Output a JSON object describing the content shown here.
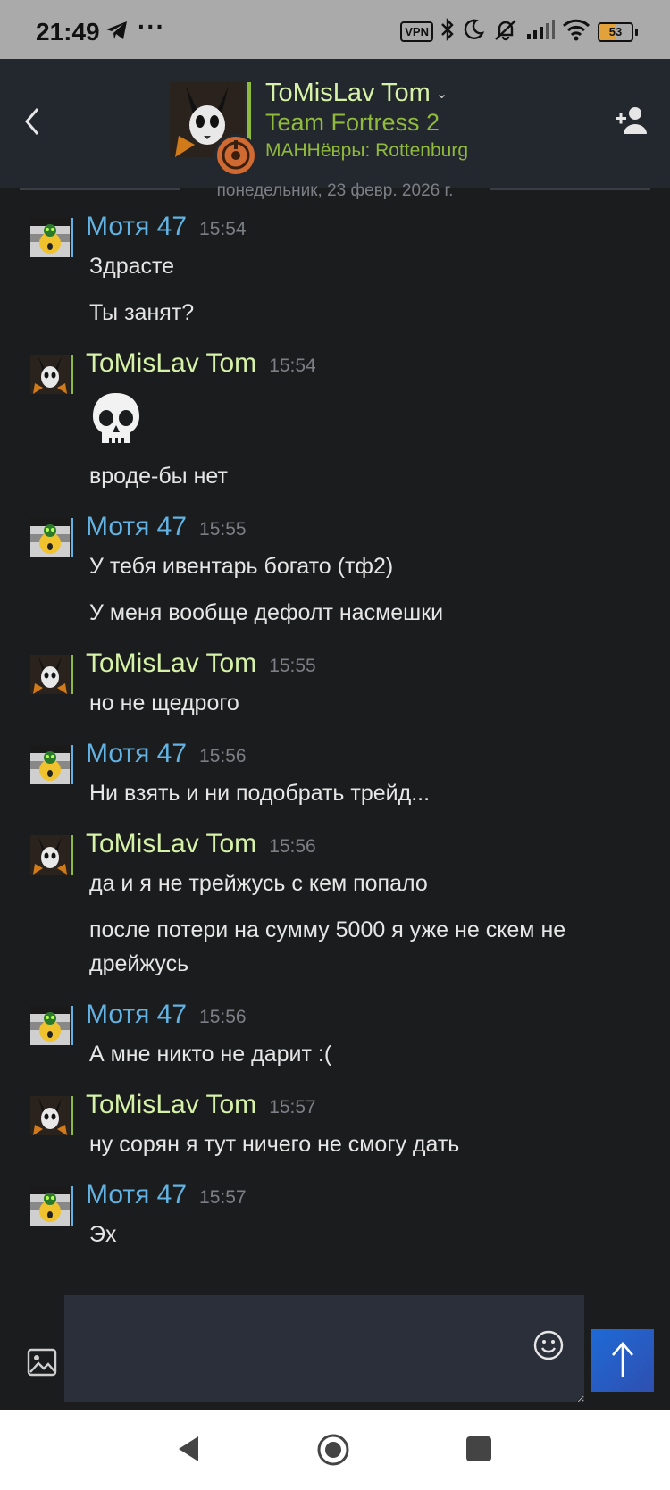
{
  "status_bar": {
    "time": "21:49",
    "more": "···",
    "vpn": "VPN",
    "battery_level": "53"
  },
  "header": {
    "name": "ToMisLav Tom",
    "game": "Team Fortress 2",
    "server": "MAHHёвры: Rottenburg",
    "accent_green": "#90ba3c",
    "name_color": "#d6f2a8"
  },
  "date_separator": "понедельник, 23 февр. 2026 г.",
  "messages": [
    {
      "user": "Мотя 47",
      "time": "15:54",
      "texts": [
        "Здрасте",
        "Ты занят?"
      ]
    },
    {
      "user": "ToMisLav Tom",
      "time": "15:54",
      "emoji": "skull",
      "texts": [
        "вроде-бы нет"
      ]
    },
    {
      "user": "Мотя 47",
      "time": "15:55",
      "texts": [
        "У тебя ивентарь богато (тф2)",
        "У меня вообще дефолт насмешки"
      ]
    },
    {
      "user": "ToMisLav Tom",
      "time": "15:55",
      "texts": [
        "но не щедрого"
      ]
    },
    {
      "user": "Мотя 47",
      "time": "15:56",
      "texts": [
        "Ни взять и ни подобрать трейд..."
      ]
    },
    {
      "user": "ToMisLav Tom",
      "time": "15:56",
      "texts": [
        "да и я не трейжусь с кем попало",
        "после потери на сумму 5000 я уже не скем не дрейжусь"
      ]
    },
    {
      "user": "Мотя 47",
      "time": "15:56",
      "texts": [
        "А мне никто не дарит :("
      ]
    },
    {
      "user": "ToMisLav Tom",
      "time": "15:57",
      "texts": [
        "ну сорян я тут ничего не смогу дать"
      ]
    },
    {
      "user": "Мотя 47",
      "time": "15:57",
      "texts": [
        "Эх"
      ]
    }
  ],
  "composer": {
    "input_value": "",
    "send_color": "#1e6ad6"
  }
}
